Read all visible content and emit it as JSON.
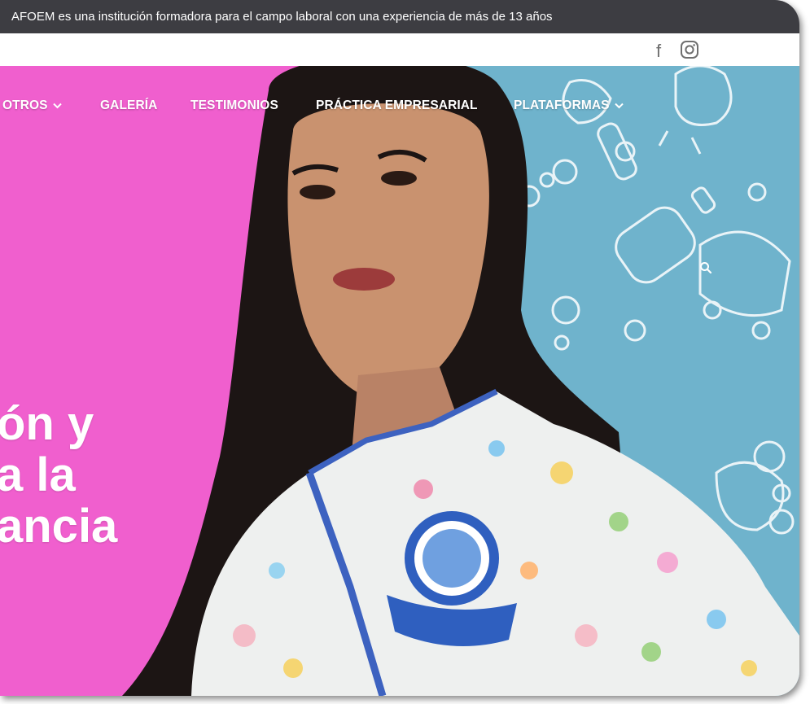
{
  "topbar": {
    "text": "AFOEM es una institución formadora para el campo laboral con una experiencia de más de 13 años"
  },
  "social": {
    "facebook_glyph": "f"
  },
  "nav": {
    "items": [
      {
        "label": "OTROS",
        "has_dropdown": true
      },
      {
        "label": "GALERÍA",
        "has_dropdown": false
      },
      {
        "label": "TESTIMONIOS",
        "has_dropdown": false
      },
      {
        "label": "PRÁCTICA EMPRESARIAL",
        "has_dropdown": false
      },
      {
        "label": "PLATAFORMAS",
        "has_dropdown": true
      }
    ]
  },
  "hero": {
    "headline_lines": [
      "ón y",
      "a la",
      "ancia"
    ],
    "colors": {
      "pink": "#f05fce",
      "blue": "#6fb3cc",
      "topbar": "#3d3d42"
    }
  },
  "icons": [
    "facebook-icon",
    "instagram-icon",
    "search-icon",
    "chevron-down-icon"
  ]
}
